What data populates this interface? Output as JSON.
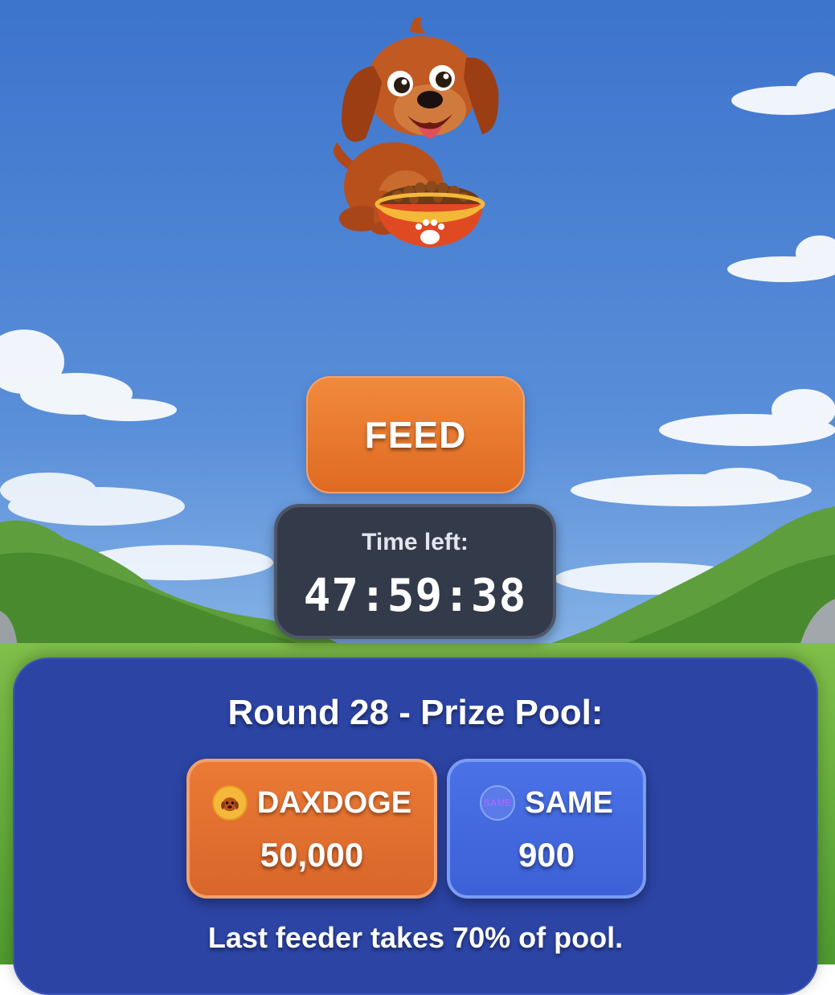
{
  "feed": {
    "label": "FEED"
  },
  "timer": {
    "label": "Time left:",
    "value": "47:59:38"
  },
  "pool": {
    "title": "Round 28 - Prize Pool:",
    "tokens": [
      {
        "name": "DAXDOGE",
        "amount": "50,000",
        "icon": "dog-coin-icon"
      },
      {
        "name": "SAME",
        "amount": "900",
        "icon": "same-coin-icon",
        "icon_text": "SAME"
      }
    ],
    "note": "Last feeder takes 70% of pool."
  },
  "colors": {
    "sky_top": "#3f78d0",
    "sky_bottom": "#9cc4ec",
    "feed_button": "#e8742c",
    "timer_bg": "#333a4a",
    "panel_bg": "#2c44a4",
    "daxdoge_card": "#e0702f",
    "same_card": "#4468dc"
  }
}
